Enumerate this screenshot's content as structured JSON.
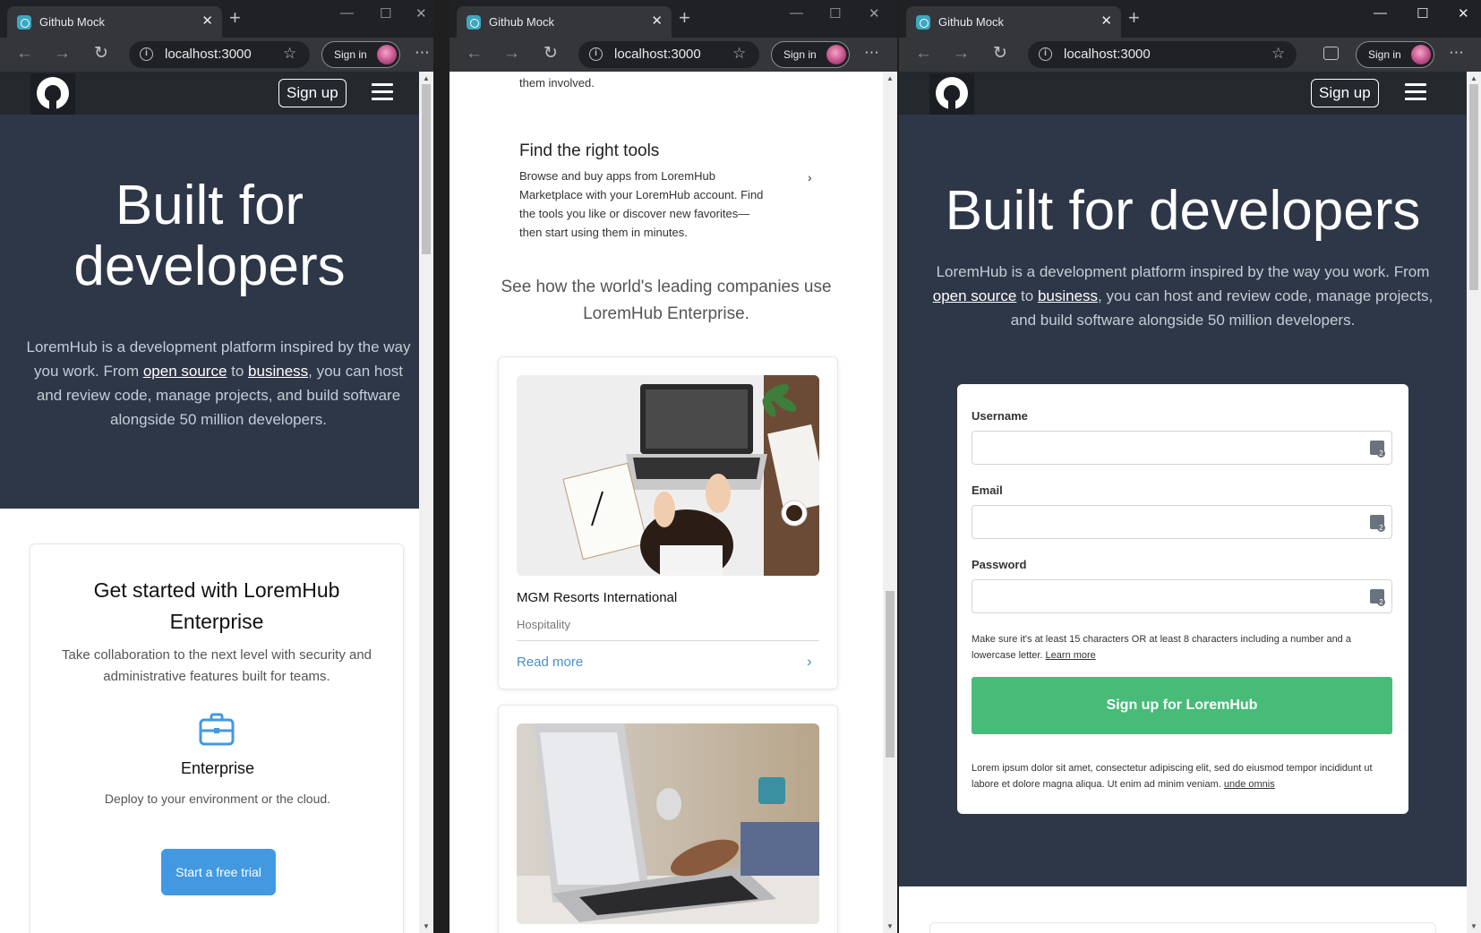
{
  "browser": {
    "tab_title": "Github Mock",
    "url": "localhost:3000",
    "signin_label": "Sign in",
    "more_label": "⋯"
  },
  "site": {
    "signup_label": "Sign up",
    "hero_title": "Built for developers",
    "hero_title_line1": "Built for",
    "hero_title_line2": "developers",
    "hero_text_a": "LoremHub is a development platform inspired by the way you work. From ",
    "hero_link_open_source": "open source",
    "hero_text_to": " to ",
    "hero_link_business": "business",
    "hero_text_b": ", you can host and review code, manage projects, and build software alongside 50 million developers."
  },
  "enterprise_card": {
    "title": "Get started with LoremHub Enterprise",
    "subtitle": "Take collaboration to the next level with security and administrative features built for teams.",
    "feature_title": "Enterprise",
    "feature_text": "Deploy to your environment or the cloud.",
    "cta_label": "Start a free trial"
  },
  "middle": {
    "involved_tail": "them involved.",
    "tools_title": "Find the right tools",
    "tools_text": "Browse and buy apps from LoremHub Marketplace with your LoremHub account. Find the tools you like or discover new favorites—then start using them in minutes.",
    "companies_heading": "See how the world's leading companies use LoremHub Enterprise.",
    "company1_name": "MGM Resorts International",
    "company1_category": "Hospitality",
    "read_more": "Read more"
  },
  "form": {
    "username_label": "Username",
    "email_label": "Email",
    "password_label": "Password",
    "password_hint": "Make sure it's at least 15 characters OR at least 8 characters including a number and a lowercase letter.",
    "learn_more": "Learn more",
    "submit_label": "Sign up for LoremHub",
    "legal_text": "Lorem ipsum dolor sit amet, consectetur adipiscing elit, sed do eiusmod tempor incididunt ut labore et dolore magna aliqua. Ut enim ad minim veniam.",
    "legal_link": "unde omnis"
  },
  "colors": {
    "hero_bg": "#2e3748",
    "header_bg": "#24292e",
    "cta_blue": "#4299e1",
    "signup_green": "#48bb78",
    "link_blue": "#4a90c8"
  }
}
